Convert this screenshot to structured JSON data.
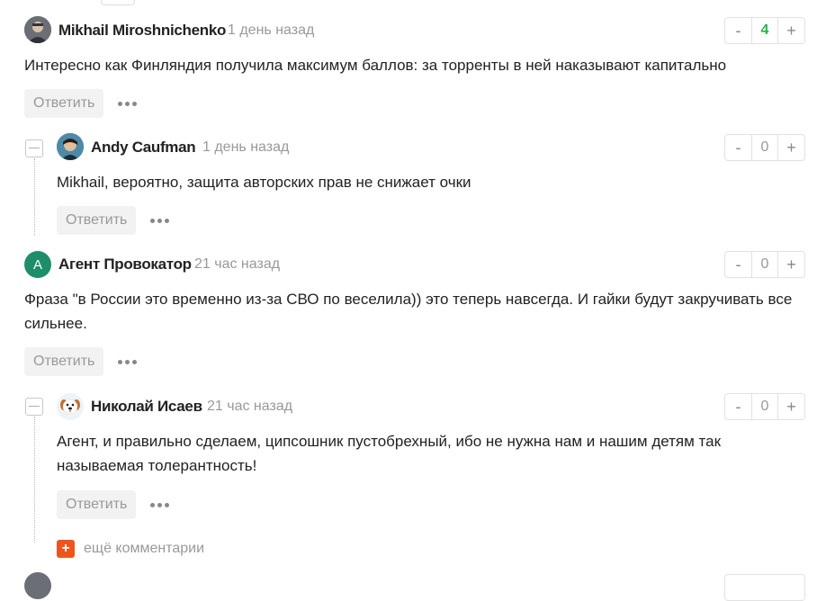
{
  "comments": [
    {
      "author": "Mikhail Miroshnichenko",
      "time": "1 день назад",
      "text": "Интересно как Финляндия получила максимум баллов: за торренты в ней наказывают капитально",
      "score": "4",
      "reply_label": "Ответить"
    },
    {
      "author": "Andy Caufman",
      "time": "1 день назад",
      "text": "Mikhail, вероятно, защита авторских прав не снижает очки",
      "score": "0",
      "reply_label": "Ответить"
    },
    {
      "author": "Агент Провокатор",
      "time": "21 час назад",
      "text": "Фраза \"в России это временно из-за СВО по веселила)) это теперь навсегда. И гайки будут закручивать все сильнее.",
      "score": "0",
      "reply_label": "Ответить",
      "avatar_letter": "А"
    },
    {
      "author": "Николай Исаев",
      "time": "21 час назад",
      "text": "Агент, и правильно сделаем, ципсошник пустобрехный, ибо не нужна нам и нашим детям так называемая толерантность!",
      "score": "0",
      "reply_label": "Ответить"
    }
  ],
  "vote": {
    "minus": "-",
    "plus": "+"
  },
  "more_comments": {
    "icon": "+",
    "label": "ещё комментарии"
  },
  "colors": {
    "accent": "#f0541e",
    "positive": "#2bb24c",
    "avatar_green": "#1e8e6a"
  }
}
